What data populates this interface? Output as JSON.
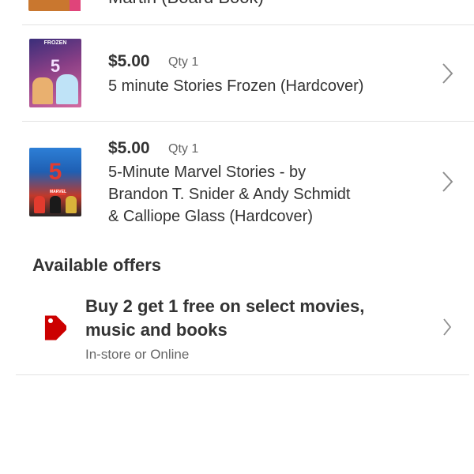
{
  "items": [
    {
      "title": "Martin (Board Book)"
    },
    {
      "price": "$5.00",
      "qty": "Qty 1",
      "title": "5 minute Stories Frozen (Hardcover)",
      "cover": {
        "brand": "FROZEN",
        "number": "5"
      }
    },
    {
      "price": "$5.00",
      "qty": "Qty 1",
      "title_lines": [
        "5-Minute Marvel Stories -  by",
        "Brandon T. Snider & Andy Schmidt",
        "& Calliope Glass (Hardcover)"
      ],
      "cover": {
        "number": "5",
        "brand": "MARVEL"
      }
    }
  ],
  "offers_section": {
    "title": "Available offers",
    "offers": [
      {
        "title_lines": [
          "Buy 2 get 1 free on select movies,",
          "music and books"
        ],
        "subtitle": "In-store or Online",
        "icon": "tag-icon"
      }
    ]
  },
  "colors": {
    "accent": "#cc0000",
    "text": "#333333",
    "muted": "#666666",
    "divider": "#e2e2e2",
    "chevron": "#8e8e8e"
  }
}
